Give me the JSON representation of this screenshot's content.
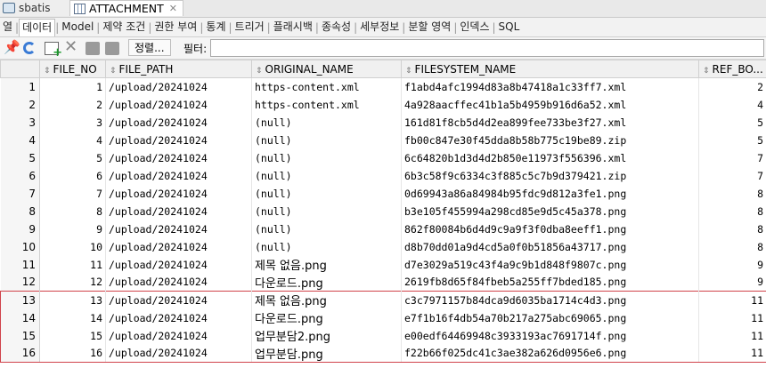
{
  "tabs": [
    {
      "label": "sbatis",
      "icon": "database-icon"
    },
    {
      "label": "ATTACHMENT",
      "icon": "table-icon",
      "close": "✕"
    }
  ],
  "subtabs": [
    "열",
    "데이터",
    "Model",
    "제약 조건",
    "권한 부여",
    "통계",
    "트리거",
    "플래시백",
    "종속성",
    "세부정보",
    "분할 영역",
    "인덱스",
    "SQL"
  ],
  "toolbar": {
    "sort_label": "정렬...",
    "filter_label": "필터:",
    "filter_value": ""
  },
  "grid": {
    "columns": [
      "FILE_NO",
      "FILE_PATH",
      "ORIGINAL_NAME",
      "FILESYSTEM_NAME",
      "REF_BO..."
    ],
    "rows": [
      {
        "n": "1",
        "file_no": "1",
        "path": "/upload/20241024",
        "orig": "https-content.xml",
        "fs": "f1abd4afc1994d83a8b47418a1c33ff7.xml",
        "ref": "2"
      },
      {
        "n": "2",
        "file_no": "2",
        "path": "/upload/20241024",
        "orig": "https-content.xml",
        "fs": "4a928aacffec41b1a5b4959b916d6a52.xml",
        "ref": "4"
      },
      {
        "n": "3",
        "file_no": "3",
        "path": "/upload/20241024",
        "orig": "(null)",
        "fs": "161d81f8cb5d4d2ea899fee733be3f27.xml",
        "ref": "5"
      },
      {
        "n": "4",
        "file_no": "4",
        "path": "/upload/20241024",
        "orig": "(null)",
        "fs": "fb00c847e30f45dda8b58b775c19be89.zip",
        "ref": "5"
      },
      {
        "n": "5",
        "file_no": "5",
        "path": "/upload/20241024",
        "orig": "(null)",
        "fs": "6c64820b1d3d4d2b850e11973f556396.xml",
        "ref": "7"
      },
      {
        "n": "6",
        "file_no": "6",
        "path": "/upload/20241024",
        "orig": "(null)",
        "fs": "6b3c58f9c6334c3f885c5c7b9d379421.zip",
        "ref": "7"
      },
      {
        "n": "7",
        "file_no": "7",
        "path": "/upload/20241024",
        "orig": "(null)",
        "fs": "0d69943a86a84984b95fdc9d812a3fe1.png",
        "ref": "8"
      },
      {
        "n": "8",
        "file_no": "8",
        "path": "/upload/20241024",
        "orig": "(null)",
        "fs": "b3e105f455994a298cd85e9d5c45a378.png",
        "ref": "8"
      },
      {
        "n": "9",
        "file_no": "9",
        "path": "/upload/20241024",
        "orig": "(null)",
        "fs": "862f80084b6d4d9c9a9f3f0dba8eeff1.png",
        "ref": "8"
      },
      {
        "n": "10",
        "file_no": "10",
        "path": "/upload/20241024",
        "orig": "(null)",
        "fs": "d8b70dd01a9d4cd5a0f0b51856a43717.png",
        "ref": "8"
      },
      {
        "n": "11",
        "file_no": "11",
        "path": "/upload/20241024",
        "orig": "제목 없음.png",
        "fs": "d7e3029a519c43f4a9c9b1d848f9807c.png",
        "ref": "9"
      },
      {
        "n": "12",
        "file_no": "12",
        "path": "/upload/20241024",
        "orig": "다운로드.png",
        "fs": "2619fb8d65f84fbeb5a255ff7bded185.png",
        "ref": "9"
      },
      {
        "n": "13",
        "file_no": "13",
        "path": "/upload/20241024",
        "orig": "제목 없음.png",
        "fs": "c3c7971157b84dca9d6035ba1714c4d3.png",
        "ref": "11"
      },
      {
        "n": "14",
        "file_no": "14",
        "path": "/upload/20241024",
        "orig": "다운로드.png",
        "fs": "e7f1b16f4db54a70b217a275abc69065.png",
        "ref": "11"
      },
      {
        "n": "15",
        "file_no": "15",
        "path": "/upload/20241024",
        "orig": "업무분담2.png",
        "fs": "e00edf64469948c3933193ac7691714f.png",
        "ref": "11"
      },
      {
        "n": "16",
        "file_no": "16",
        "path": "/upload/20241024",
        "orig": "업무분담.png",
        "fs": "f22b66f025dc41c3ae382a626d0956e6.png",
        "ref": "11"
      }
    ],
    "highlight_color": "#d0424a"
  }
}
